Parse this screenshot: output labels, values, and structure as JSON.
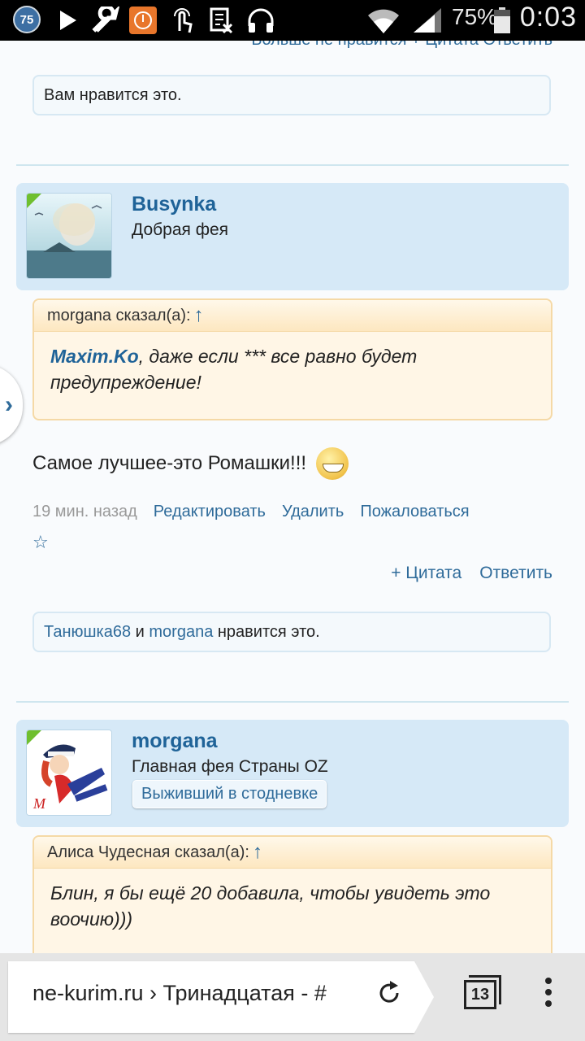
{
  "status_bar": {
    "notification_badge": "75",
    "battery": "75%",
    "time": "0:03"
  },
  "top_cut_links": "Больше не нравится  + Цитата  Ответить",
  "first_likes": "Вам нравится это.",
  "post1": {
    "username": "Busynka",
    "user_title": "Добрая фея",
    "quote_author": "morgana сказал(а):",
    "quote_ref": "Maxim.Ko",
    "quote_text": ", даже если *** все равно будет предупреждение!",
    "message": "Самое лучшее-это Ромашки!!!",
    "time_ago": "19 мин. назад",
    "edit": "Редактировать",
    "delete": "Удалить",
    "report": "Пожаловаться",
    "star": "☆",
    "quote_action": "+ Цитата",
    "reply_action": "Ответить",
    "likes_user1": "Танюшка68",
    "likes_and": "и",
    "likes_user2": "morgana",
    "likes_suffix": "нравится это."
  },
  "post2": {
    "username": "morgana",
    "user_title": "Главная фея Страны OZ",
    "user_badge": "Выживший в стодневке",
    "quote_author": "Алиса Чудесная сказал(а):",
    "quote_text": "Блин, я бы ещё 20 добавила, чтобы увидеть это воочию)))"
  },
  "browser": {
    "url": "ne-kurim.ru › Тринадцатая - #",
    "tab_count": "13"
  }
}
